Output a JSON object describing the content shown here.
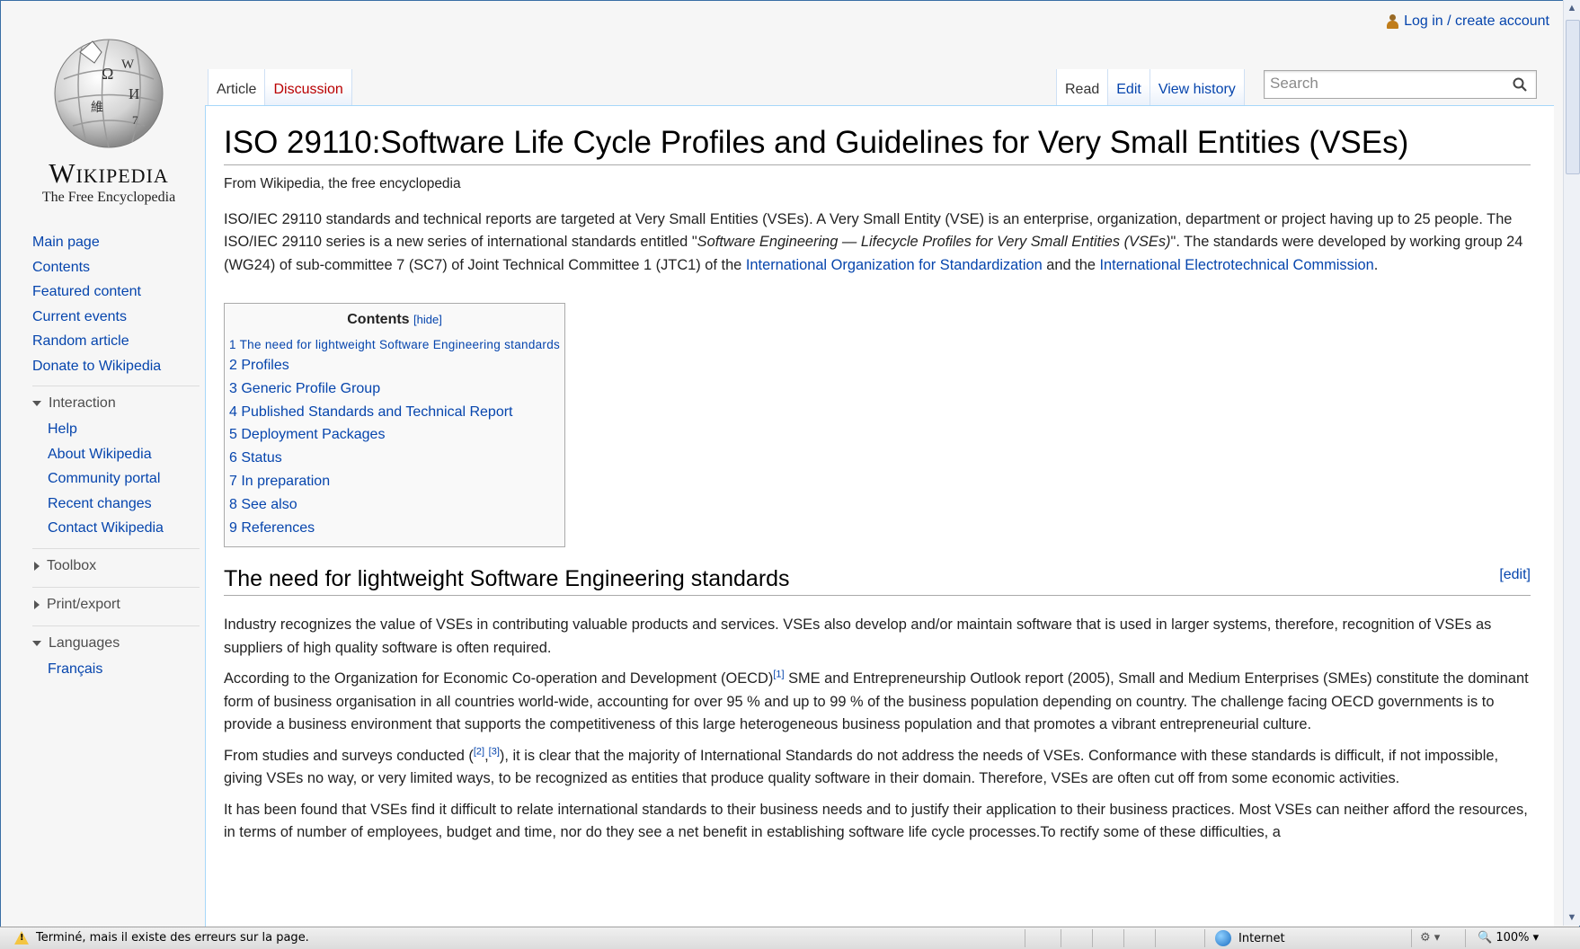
{
  "logo": {
    "wordmark": "Wikipedia",
    "tagline": "The Free Encyclopedia"
  },
  "personal": {
    "login_label": "Log in / create account",
    "icon": "user-icon"
  },
  "tabs": {
    "article": "Article",
    "discussion": "Discussion",
    "read": "Read",
    "edit": "Edit",
    "history": "View history"
  },
  "search": {
    "placeholder": "Search",
    "value": "",
    "icon": "search-icon"
  },
  "sidebar": {
    "main": [
      "Main page",
      "Contents",
      "Featured content",
      "Current events",
      "Random article",
      "Donate to Wikipedia"
    ],
    "interaction": {
      "title": "Interaction",
      "items": [
        "Help",
        "About Wikipedia",
        "Community portal",
        "Recent changes",
        "Contact Wikipedia"
      ]
    },
    "toolbox": "Toolbox",
    "print": "Print/export",
    "languages": {
      "title": "Languages",
      "items": [
        "Français"
      ]
    }
  },
  "article": {
    "title": "ISO 29110:Software Life Cycle Profiles and Guidelines for Very Small Entities (VSEs)",
    "from": "From Wikipedia, the free encyclopedia",
    "intro": {
      "t1": "ISO/IEC 29110 standards and technical reports are targeted at Very Small Entities (VSEs). A Very Small Entity (VSE) is an enterprise, organization, department or project having up to 25 people. The ISO/IEC 29110 series is a new series of international standards entitled \"",
      "italic": "Software Engineering — Lifecycle Profiles for Very Small Entities (VSEs)",
      "t2": "\". The standards were developed by working group 24 (WG24) of sub-committee 7 (SC7) of Joint Technical Committee 1 (JTC1) of the ",
      "link1": "International Organization for Standardization",
      "t3": " and the ",
      "link2": "International Electrotechnical Commission",
      "t4": "."
    },
    "toc": {
      "title": "Contents",
      "hide": "[hide]",
      "items": [
        {
          "num": "1",
          "label": "The need for lightweight Software Engineering standards"
        },
        {
          "num": "2",
          "label": "Profiles"
        },
        {
          "num": "3",
          "label": "Generic Profile Group"
        },
        {
          "num": "4",
          "label": "Published Standards and Technical Report"
        },
        {
          "num": "5",
          "label": "Deployment Packages"
        },
        {
          "num": "6",
          "label": "Status"
        },
        {
          "num": "7",
          "label": "In preparation"
        },
        {
          "num": "8",
          "label": "See also"
        },
        {
          "num": "9",
          "label": "References"
        }
      ]
    },
    "section1": {
      "heading": "The need for lightweight Software Engineering standards",
      "edit": "[edit]",
      "p1": "Industry recognizes the value of VSEs in contributing valuable products and services. VSEs also develop and/or maintain software that is used in larger systems, therefore, recognition of VSEs as suppliers of high quality software is often required.",
      "p2a": "According to the Organization for Economic Co-operation and Development (OECD)",
      "p2ref": "[1]",
      "p2b": " SME and Entrepreneurship Outlook report (2005), Small and Medium Enterprises (SMEs) constitute the dominant form of business organisation in all countries world-wide, accounting for over 95 % and up to 99 % of the business population depending on country. The challenge facing OECD governments is to provide a business environment that supports the competitiveness of this large heterogeneous business population and that promotes a vibrant entrepreneurial culture.",
      "p3a": "From studies and surveys conducted (",
      "p3ref1": "[2]",
      "p3mid": ",",
      "p3ref2": "[3]",
      "p3b": "), it is clear that the majority of International Standards do not address the needs of VSEs. Conformance with these standards is difficult, if not impossible, giving VSEs no way, or very limited ways, to be recognized as entities that produce quality software in their domain. Therefore, VSEs are often cut off from some economic activities.",
      "p4": "It has been found that VSEs find it difficult to relate international standards to their business needs and to justify their application to their business practices. Most VSEs can neither afford the resources, in terms of number of employees, budget and time, nor do they see a net benefit in establishing software life cycle processes.To rectify some of these difficulties, a"
    }
  },
  "statusbar": {
    "message": "Terminé, mais il existe des erreurs sur la page.",
    "zone": "Internet",
    "zoom": "100%"
  }
}
